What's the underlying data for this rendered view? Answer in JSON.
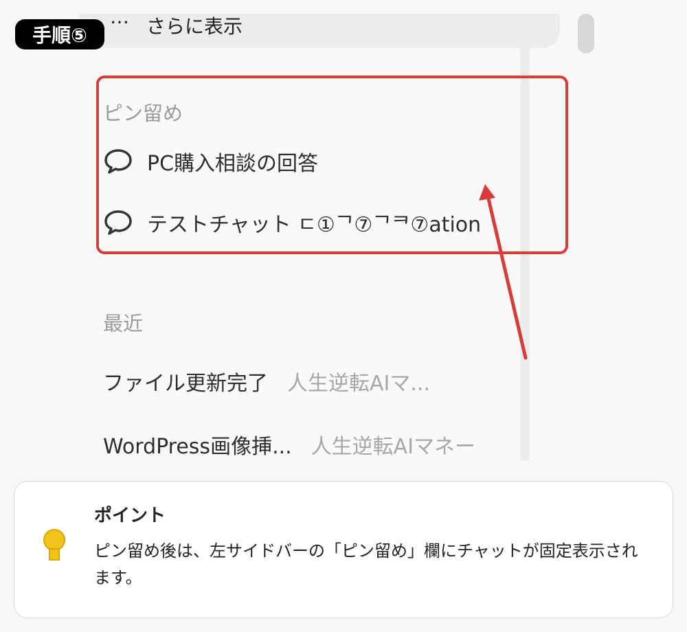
{
  "step_badge": "手順⑤",
  "sidebar": {
    "show_more": {
      "dots": "…",
      "label": "さらに表示"
    },
    "pinned": {
      "label": "ピン留め",
      "items": [
        {
          "title": "PC購入相談の回答",
          "icon": "chat-bubble-icon"
        },
        {
          "title": "テストチャット ㄷ①ᄀ⑦ᄀᄏ⑦ation",
          "icon": "chat-bubble-icon"
        }
      ]
    },
    "recent": {
      "label": "最近",
      "items": [
        {
          "title": "ファイル更新完了",
          "meta": "人生逆転AIマ..."
        },
        {
          "title": "WordPress画像挿...",
          "meta": "人生逆転AIマネー"
        }
      ]
    }
  },
  "point": {
    "title": "ポイント",
    "body": "ピン留め後は、左サイドバーの「ピン留め」欄にチャットが固定表示されます。",
    "icon": "lightbulb-icon"
  },
  "colors": {
    "highlight": "#d93a3a",
    "bulb": "#f4c21c",
    "badge": "#000000"
  }
}
